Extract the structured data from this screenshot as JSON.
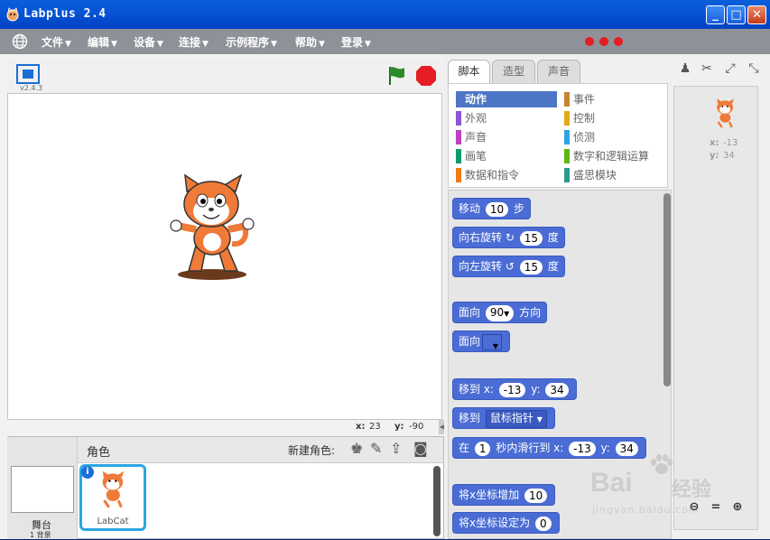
{
  "window": {
    "title": "Labplus 2.4"
  },
  "menu": [
    {
      "label": "文件"
    },
    {
      "label": "编辑"
    },
    {
      "label": "设备"
    },
    {
      "label": "连接"
    },
    {
      "label": "示例程序"
    },
    {
      "label": "帮助"
    },
    {
      "label": "登录"
    }
  ],
  "stage": {
    "version": "v2.4.3",
    "x_label": "x:",
    "x_value": "23",
    "y_label": "y:",
    "y_value": "-90"
  },
  "sprites": {
    "header": "角色",
    "new_sprite_label": "新建角色:",
    "stage_label": "舞台",
    "stage_sub": "1 背景",
    "sprite_name": "LabCat"
  },
  "tabs": [
    {
      "label": "脚本"
    },
    {
      "label": "造型"
    },
    {
      "label": "声音"
    }
  ],
  "categories": [
    {
      "label": "动作",
      "color": "#4a6cd4"
    },
    {
      "label": "事件",
      "color": "#c88330"
    },
    {
      "label": "外观",
      "color": "#8a55d7"
    },
    {
      "label": "控制",
      "color": "#e1a91a"
    },
    {
      "label": "声音",
      "color": "#bb42c3"
    },
    {
      "label": "侦测",
      "color": "#2ca5e2"
    },
    {
      "label": "画笔",
      "color": "#0e9a6c"
    },
    {
      "label": "数字和逻辑运算",
      "color": "#5cb712"
    },
    {
      "label": "数据和指令",
      "color": "#ee7d16"
    },
    {
      "label": "盛思模块",
      "color": "#2b9a8c"
    }
  ],
  "blocks": {
    "move": {
      "label": "移动",
      "value": "10",
      "suffix": "步"
    },
    "turn_right": {
      "label": "向右旋转",
      "value": "15",
      "suffix": "度"
    },
    "turn_left": {
      "label": "向左旋转",
      "value": "15",
      "suffix": "度"
    },
    "point_dir": {
      "label": "面向",
      "value": "90",
      "suffix": "方向"
    },
    "point_towards": {
      "label": "面向"
    },
    "goto_xy": {
      "label": "移到 x:",
      "x": "-13",
      "ylabel": "y:",
      "y": "34"
    },
    "goto": {
      "label": "移到",
      "option": "鼠标指针"
    },
    "glide": {
      "label": "在",
      "secs": "1",
      "mid": "秒内滑行到 x:",
      "x": "-13",
      "ylabel": "y:",
      "y": "34"
    },
    "change_x": {
      "label": "将x坐标增加",
      "value": "10"
    },
    "set_x": {
      "label": "将x坐标设定为",
      "value": "0"
    }
  },
  "sprite_info": {
    "x_label": "x:",
    "x_value": "-13",
    "y_label": "y:",
    "y_value": "34"
  },
  "watermark": {
    "brand": "Bai",
    "brand2": "经验",
    "url": "jingyan.baidu.com"
  },
  "colors": {
    "accent": "#4a6cd4",
    "stop": "#e51e24",
    "flag": "#2d8a2d"
  }
}
